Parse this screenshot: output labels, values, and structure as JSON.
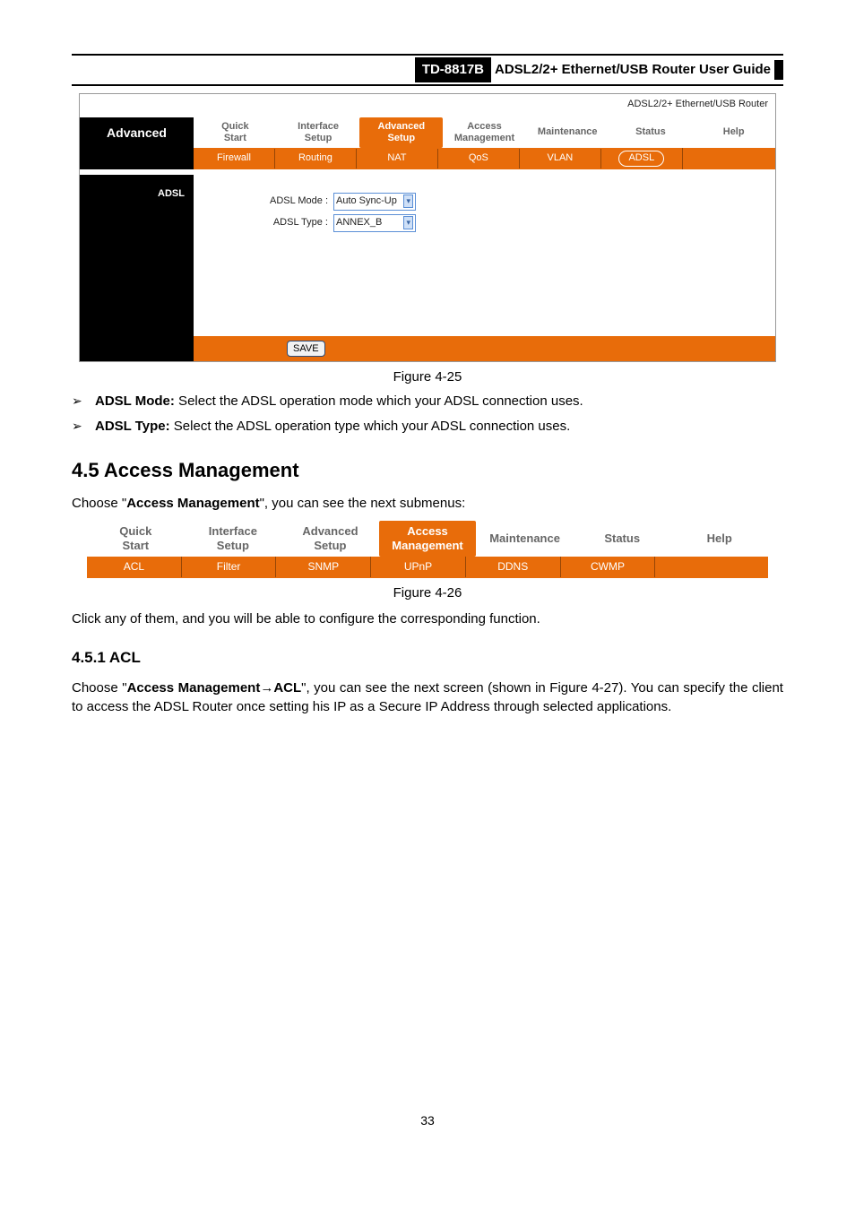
{
  "header": {
    "model": "TD-8817B",
    "title": "ADSL2/2+ Ethernet/USB Router User Guide"
  },
  "figure425": {
    "device_label": "ADSL2/2+ Ethernet/USB Router",
    "side_title": "Advanced",
    "tabs": [
      "Quick\nStart",
      "Interface\nSetup",
      "Advanced\nSetup",
      "Access\nManagement",
      "Maintenance",
      "Status",
      "Help"
    ],
    "subtabs": [
      "Firewall",
      "Routing",
      "NAT",
      "QoS",
      "VLAN",
      "ADSL"
    ],
    "section_title": "ADSL",
    "adsl_mode_label": "ADSL Mode :",
    "adsl_mode_value": "Auto Sync-Up",
    "adsl_type_label": "ADSL Type :",
    "adsl_type_value": "ANNEX_B",
    "save_button": "SAVE",
    "caption": "Figure 4-25"
  },
  "notes": {
    "adsl_mode_bold": "ADSL Mode:",
    "adsl_mode_text": " Select the ADSL operation mode which your ADSL connection uses.",
    "adsl_type_bold": "ADSL Type:",
    "adsl_type_text": " Select the ADSL operation type which your ADSL connection uses."
  },
  "section45": {
    "heading": "4.5  Access Management",
    "intro_pre": "Choose \"",
    "intro_bold": "Access Management",
    "intro_post": "\", you can see the next submenus:"
  },
  "figure426": {
    "tabs": [
      "Quick\nStart",
      "Interface\nSetup",
      "Advanced\nSetup",
      "Access\nManagement",
      "Maintenance",
      "Status",
      "Help"
    ],
    "subtabs": [
      "ACL",
      "Filter",
      "SNMP",
      "UPnP",
      "DDNS",
      "CWMP"
    ],
    "caption": "Figure 4-26"
  },
  "para_click": "Click any of them, and you will be able to configure the corresponding function.",
  "section451": {
    "heading": "4.5.1  ACL",
    "p_pre": "Choose \"",
    "p_bold": "Access Management→ACL",
    "p_post": "\", you can see the next screen (shown in Figure 4-27). You can specify the client to access the ADSL Router once setting his IP as a Secure IP Address through selected applications."
  },
  "page_number": "33"
}
